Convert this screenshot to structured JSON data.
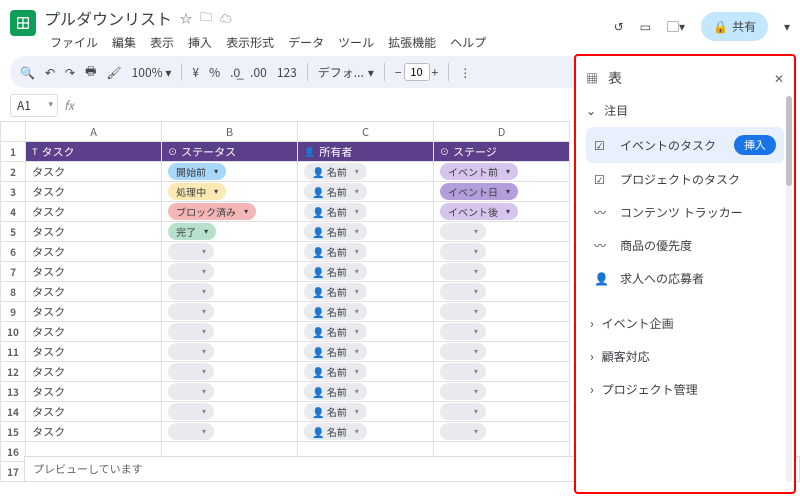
{
  "doc": {
    "title": "プルダウンリスト"
  },
  "menus": [
    "ファイル",
    "編集",
    "表示",
    "挿入",
    "表示形式",
    "データ",
    "ツール",
    "拡張機能",
    "ヘルプ"
  ],
  "share": "共有",
  "toolbar": {
    "zoom": "100%",
    "curr": "¥",
    "pct": "%",
    "dec0": ".0_",
    "dec00": ".00",
    "123": "123",
    "font": "デフォ...",
    "size": "10"
  },
  "cellref": "A1",
  "colLabels": [
    "A",
    "B",
    "C",
    "D"
  ],
  "headers": [
    {
      "icon": "T",
      "label": "タスク"
    },
    {
      "icon": "⊙",
      "label": "ステータス"
    },
    {
      "icon": "👤",
      "label": "所有者"
    },
    {
      "icon": "⊙",
      "label": "ステージ"
    }
  ],
  "rows": [
    {
      "n": 1,
      "task": "タスク",
      "status": {
        "t": "開始前",
        "c": "blue"
      },
      "owner": "名前",
      "stage": {
        "t": "イベント前",
        "c": "lpur"
      }
    },
    {
      "n": 2,
      "task": "タスク",
      "status": {
        "t": "処理中",
        "c": "yel"
      },
      "owner": "名前",
      "stage": {
        "t": "イベント日",
        "c": "pur"
      }
    },
    {
      "n": 3,
      "task": "タスク",
      "status": {
        "t": "ブロック済み",
        "c": "red"
      },
      "owner": "名前",
      "stage": {
        "t": "イベント後",
        "c": "lpur"
      }
    },
    {
      "n": 4,
      "task": "タスク",
      "status": {
        "t": "完了",
        "c": "grn"
      },
      "owner": "名前",
      "stage": null
    },
    {
      "n": 5,
      "task": "タスク",
      "status": null,
      "owner": "名前",
      "stage": null
    },
    {
      "n": 6,
      "task": "タスク",
      "status": null,
      "owner": "名前",
      "stage": null
    },
    {
      "n": 7,
      "task": "タスク",
      "status": null,
      "owner": "名前",
      "stage": null
    },
    {
      "n": 8,
      "task": "タスク",
      "status": null,
      "owner": "名前",
      "stage": null
    },
    {
      "n": 9,
      "task": "タスク",
      "status": null,
      "owner": "名前",
      "stage": null
    },
    {
      "n": 10,
      "task": "タスク",
      "status": null,
      "owner": "名前",
      "stage": null
    },
    {
      "n": 11,
      "task": "タスク",
      "status": null,
      "owner": "名前",
      "stage": null
    },
    {
      "n": 12,
      "task": "タスク",
      "status": null,
      "owner": "名前",
      "stage": null
    },
    {
      "n": 13,
      "task": "タスク",
      "status": null,
      "owner": "名前",
      "stage": null
    },
    {
      "n": 14,
      "task": "タスク",
      "status": null,
      "owner": "名前",
      "stage": null
    }
  ],
  "extraRows": [
    16,
    17
  ],
  "preview": "プレビューしています",
  "panel": {
    "title": "表",
    "featured": "注目",
    "items": [
      {
        "icon": "checklist",
        "label": "イベントのタスク",
        "sel": true,
        "insert": "挿入"
      },
      {
        "icon": "checklist",
        "label": "プロジェクトのタスク"
      },
      {
        "icon": "spark",
        "label": "コンテンツ トラッカー"
      },
      {
        "icon": "spark",
        "label": "商品の優先度"
      },
      {
        "icon": "person",
        "label": "求人への応募者"
      }
    ],
    "collapsed": [
      "イベント企画",
      "顧客対応",
      "プロジェクト管理"
    ]
  }
}
